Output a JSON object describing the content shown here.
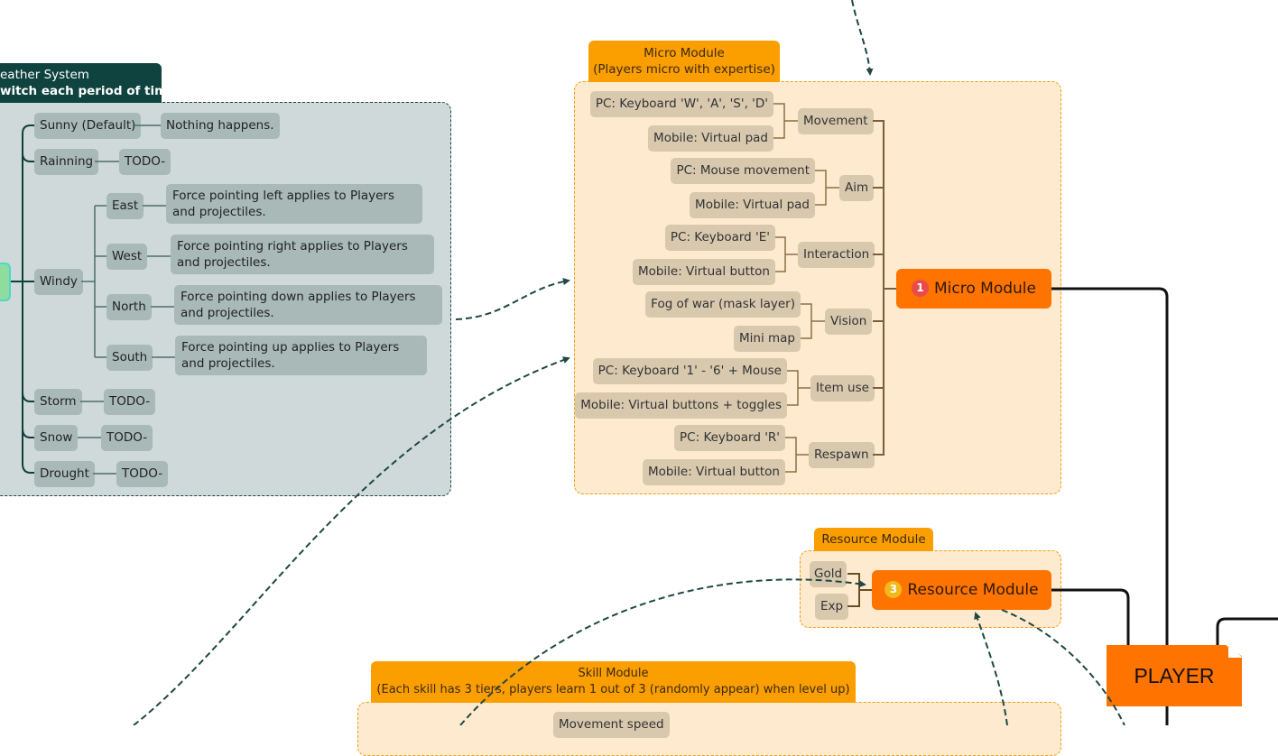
{
  "weather": {
    "title_line1": "Weather System",
    "title_line2": "(Switch each period of time)",
    "title_visible_line1": "eather System",
    "title_visible_line2": "witch each period of time)",
    "items": [
      {
        "label": "Sunny (Default)",
        "detail": "Nothing happens."
      },
      {
        "label": "Rainning",
        "detail": "TODO-"
      },
      {
        "label": "Windy",
        "children": [
          {
            "label": "East",
            "detail": "Force pointing left applies to Players and projectiles."
          },
          {
            "label": "West",
            "detail": "Force pointing right applies to Players and projectiles."
          },
          {
            "label": "North",
            "detail": "Force pointing down applies to Players and projectiles."
          },
          {
            "label": "South",
            "detail": "Force pointing up applies to Players and projectiles."
          }
        ]
      },
      {
        "label": "Storm",
        "detail": "TODO-"
      },
      {
        "label": "Snow",
        "detail": "TODO-"
      },
      {
        "label": "Drought",
        "detail": "TODO-"
      }
    ]
  },
  "micro": {
    "tab_line1": "Micro Module",
    "tab_line2": "(Players micro with expertise)",
    "main_label": "Micro Module",
    "badge": "1",
    "groups": [
      {
        "label": "Movement",
        "pc": "PC: Keyboard 'W', 'A', 'S', 'D'",
        "mobile": "Mobile: Virtual pad"
      },
      {
        "label": "Aim",
        "pc": "PC: Mouse movement",
        "mobile": "Mobile: Virtual pad"
      },
      {
        "label": "Interaction",
        "pc": "PC: Keyboard 'E'",
        "mobile": "Mobile: Virtual button"
      },
      {
        "label": "Vision",
        "pc": "Fog of war (mask layer)",
        "mobile": "Mini map"
      },
      {
        "label": "Item use",
        "pc": "PC: Keyboard '1' - '6' + Mouse",
        "mobile": "Mobile: Virtual buttons + toggles"
      },
      {
        "label": "Respawn",
        "pc": "PC: Keyboard 'R'",
        "mobile": "Mobile: Virtual button"
      }
    ]
  },
  "resource": {
    "tab": "Resource Module",
    "main_label": "Resource Module",
    "badge": "3",
    "items": [
      "Gold",
      "Exp"
    ]
  },
  "skill": {
    "tab_line1": "Skill Module",
    "tab_line2": "(Each skill has 3 tiers, players learn 1 out of 3 (randomly appear) when level up)",
    "first_item": "Movement speed"
  },
  "player": {
    "label": "PLAYER"
  },
  "colors": {
    "weather_header": "#0e4340",
    "weather_bg": "#cfd9da",
    "weather_node": "#a8b9b8",
    "module_tab": "#fb9e00",
    "module_bg": "#feebcf",
    "module_node": "#d8c8ad",
    "main_node": "#ff7300",
    "connector": "#1f4744"
  }
}
